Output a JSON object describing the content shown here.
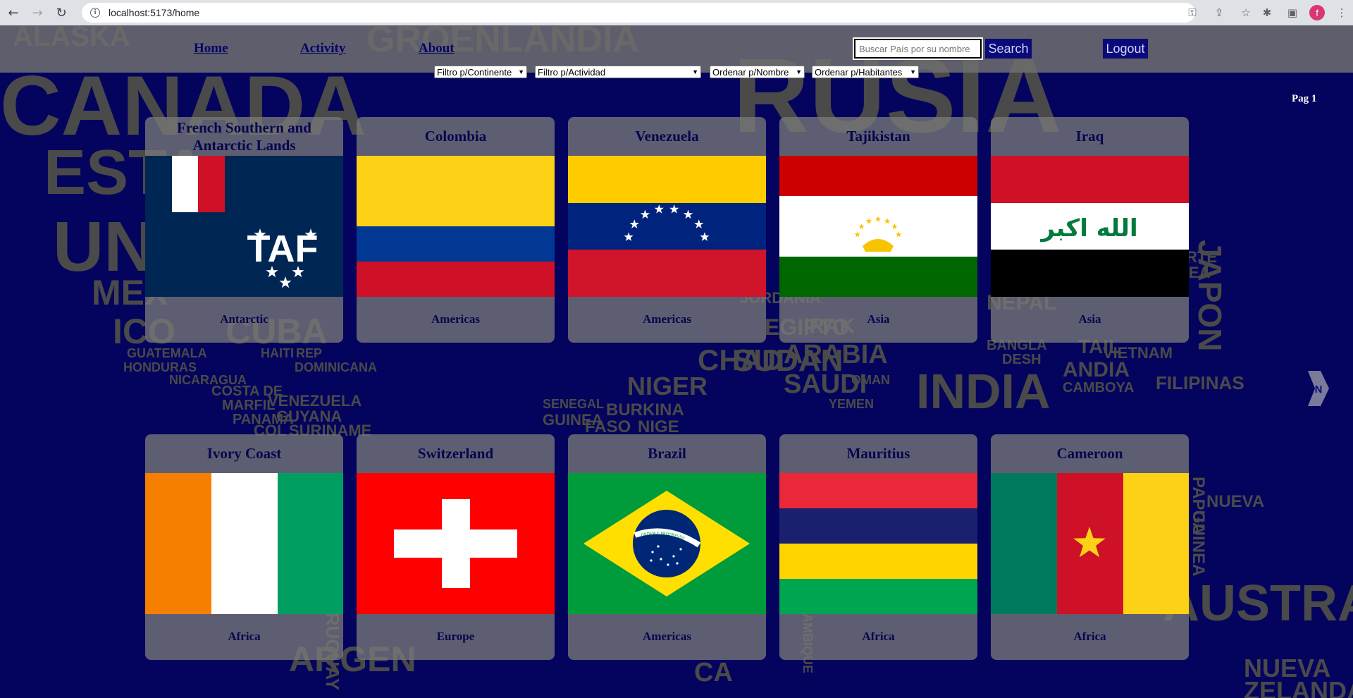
{
  "browser": {
    "url": "localhost:5173/home",
    "avatar_letter": "f"
  },
  "background_words": [
    {
      "t": "ALASKA"
    },
    {
      "t": "GROENLANDIA"
    },
    {
      "t": "CANADA"
    },
    {
      "t": "RUSIA"
    },
    {
      "t": "ESTA"
    },
    {
      "t": "UNI"
    },
    {
      "t": "MEX"
    },
    {
      "t": "ICO"
    },
    {
      "t": "CUBA"
    },
    {
      "t": "GUATEMALA"
    },
    {
      "t": "HONDURAS"
    },
    {
      "t": "NICARAGUA"
    },
    {
      "t": "HAITI"
    },
    {
      "t": "REP"
    },
    {
      "t": "DOMINICANA"
    },
    {
      "t": "COSTA DE"
    },
    {
      "t": "MARFIL"
    },
    {
      "t": "PANAMA"
    },
    {
      "t": "VENEZUELA"
    },
    {
      "t": "GUYANA"
    },
    {
      "t": "SURINAME"
    },
    {
      "t": "COL"
    },
    {
      "t": "NIGER"
    },
    {
      "t": "CHAD"
    },
    {
      "t": "SUDAN"
    },
    {
      "t": "BURKINA"
    },
    {
      "t": "FASO"
    },
    {
      "t": "NIGE"
    },
    {
      "t": "GUINEA"
    },
    {
      "t": "SENEGAL"
    },
    {
      "t": "ARABIA"
    },
    {
      "t": "SAUDI"
    },
    {
      "t": "YEMEN"
    },
    {
      "t": "OMAN"
    },
    {
      "t": "INDIA"
    },
    {
      "t": "JAPON"
    },
    {
      "t": "NEPAL"
    },
    {
      "t": "BANGLA"
    },
    {
      "t": "DESH"
    },
    {
      "t": "TAIL"
    },
    {
      "t": "ANDIA"
    },
    {
      "t": "CAMBOYA"
    },
    {
      "t": "VIETNAM"
    },
    {
      "t": "FILIPINAS"
    },
    {
      "t": "PAPUA"
    },
    {
      "t": "NUEVA"
    },
    {
      "t": "GUINEA"
    },
    {
      "t": "AUSTRALIA"
    },
    {
      "t": "NUEVA"
    },
    {
      "t": "ZELANDA"
    },
    {
      "t": "CA"
    },
    {
      "t": "JORDANIA"
    },
    {
      "t": "EGIPTO"
    },
    {
      "t": "IRAK"
    },
    {
      "t": "NORTE"
    },
    {
      "t": "COREA"
    },
    {
      "t": "URUGUAY"
    },
    {
      "t": "ARGEN"
    },
    {
      "t": "MOZAMBIQUE"
    }
  ],
  "header": {
    "nav": [
      "Home",
      "Activity",
      "About"
    ],
    "search_placeholder": "Buscar País por su nombre",
    "search_label": "Search",
    "logout_label": "Logout"
  },
  "filters": [
    "Filtro p/Continente",
    "Filtro p/Actividad",
    "Ordenar p/Nombre",
    "Ordenar p/Habitantes"
  ],
  "pagination": {
    "label": "Pag 1",
    "next_label": "N"
  },
  "countries": [
    {
      "name": "French Southern and Antarctic Lands",
      "continent": "Antarctic",
      "flag": "atf"
    },
    {
      "name": "Colombia",
      "continent": "Americas",
      "flag": "col"
    },
    {
      "name": "Venezuela",
      "continent": "Americas",
      "flag": "ven"
    },
    {
      "name": "Tajikistan",
      "continent": "Asia",
      "flag": "tjk"
    },
    {
      "name": "Iraq",
      "continent": "Asia",
      "flag": "irq"
    },
    {
      "name": "Ivory Coast",
      "continent": "Africa",
      "flag": "civ"
    },
    {
      "name": "Switzerland",
      "continent": "Europe",
      "flag": "che"
    },
    {
      "name": "Brazil",
      "continent": "Americas",
      "flag": "bra"
    },
    {
      "name": "Mauritius",
      "continent": "Africa",
      "flag": "mus"
    },
    {
      "name": "Cameroon",
      "continent": "Africa",
      "flag": "cmr"
    }
  ],
  "flag_texts": {
    "iraq": "الله اكبر",
    "brazil": "ORDEM E PROGRESSO"
  }
}
